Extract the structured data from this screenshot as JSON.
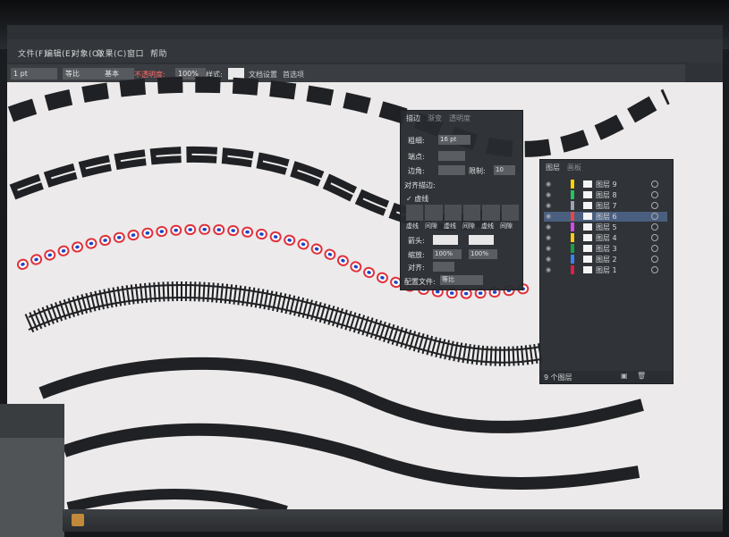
{
  "menubar": {
    "items": [
      "文件(F)",
      "编辑(E)",
      "对象(O)",
      "效果(C)",
      "窗口",
      "帮助"
    ]
  },
  "options": {
    "stroke_value": "1 pt",
    "uniform_label": "等比",
    "basic_label": "基本",
    "opacity_label": "不透明度:",
    "opacity_value": "100%",
    "style_label": "样式:",
    "doc_setup_label": "文档设置",
    "prefs_label": "首选项"
  },
  "stroke_panel": {
    "tabs": [
      "描边",
      "渐变",
      "透明度"
    ],
    "weight_label": "粗细:",
    "weight_value": "16 pt",
    "cap_label": "端点:",
    "corner_label": "边角:",
    "limit_label": "限制:",
    "limit_value": "10",
    "align_label": "对齐描边:",
    "dashed_label": "虚线",
    "dash_fields": [
      "虚线",
      "间隙",
      "虚线",
      "间隙",
      "虚线",
      "间隙"
    ],
    "arrow_label": "箭头:",
    "scale_label": "缩放:",
    "scale_values": [
      "100%",
      "100%"
    ],
    "align_arrow_label": "对齐:",
    "profile_label": "配置文件:",
    "profile_value": "等比"
  },
  "layers_panel": {
    "tabs": [
      "图层",
      "画板"
    ],
    "rows": [
      {
        "name": "图层 9",
        "color": "#ffd400"
      },
      {
        "name": "图层 8",
        "color": "#22c55e"
      },
      {
        "name": "图层 7",
        "color": "#9ca3af"
      },
      {
        "name": "图层 6",
        "color": "#ef4444",
        "selected": true
      },
      {
        "name": "图层 5",
        "color": "#d946ef"
      },
      {
        "name": "图层 4",
        "color": "#facc15"
      },
      {
        "name": "图层 3",
        "color": "#16a34a"
      },
      {
        "name": "图层 2",
        "color": "#3b82f6"
      },
      {
        "name": "图层 1",
        "color": "#e11d48"
      }
    ],
    "footer_label": "9 个图层"
  },
  "colors": {
    "canvas": "#eceaea",
    "stroke": "#202124",
    "red_ring": "#e0303a",
    "blue_dot": "#1a44c6",
    "panel_bg": "#2a2d31"
  }
}
